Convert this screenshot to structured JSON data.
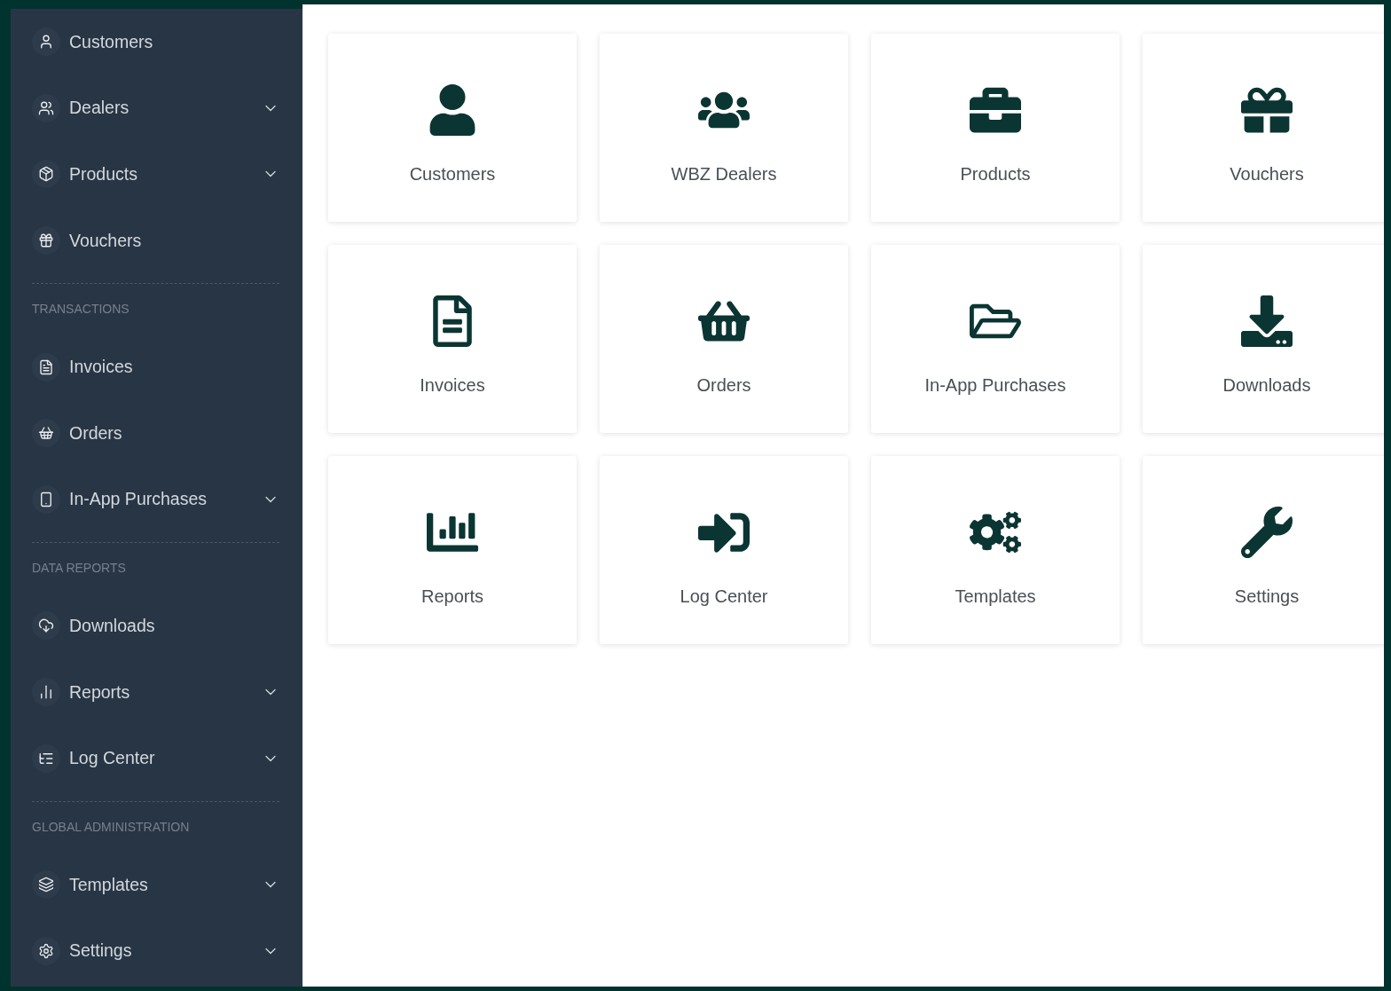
{
  "sidebar": {
    "entries": [
      {
        "kind": "item",
        "label": "Customers",
        "expandable": false
      },
      {
        "kind": "item",
        "label": "Dealers",
        "expandable": true
      },
      {
        "kind": "item",
        "label": "Products",
        "expandable": true
      },
      {
        "kind": "item",
        "label": "Vouchers",
        "expandable": false
      },
      {
        "kind": "heading",
        "label": "TRANSACTIONS"
      },
      {
        "kind": "item",
        "label": "Invoices",
        "expandable": false
      },
      {
        "kind": "item",
        "label": "Orders",
        "expandable": false
      },
      {
        "kind": "item",
        "label": "In-App Purchases",
        "expandable": true
      },
      {
        "kind": "heading",
        "label": "DATA REPORTS"
      },
      {
        "kind": "item",
        "label": "Downloads",
        "expandable": false
      },
      {
        "kind": "item",
        "label": "Reports",
        "expandable": true
      },
      {
        "kind": "item",
        "label": "Log Center",
        "expandable": true
      },
      {
        "kind": "heading",
        "label": "GLOBAL ADMINISTRATION"
      },
      {
        "kind": "item",
        "label": "Templates",
        "expandable": true
      },
      {
        "kind": "item",
        "label": "Settings",
        "expandable": true
      }
    ]
  },
  "tiles": [
    {
      "label": "Customers"
    },
    {
      "label": "WBZ Dealers"
    },
    {
      "label": "Products"
    },
    {
      "label": "Vouchers"
    },
    {
      "label": "Invoices"
    },
    {
      "label": "Orders"
    },
    {
      "label": "In-App Purchases"
    },
    {
      "label": "Downloads"
    },
    {
      "label": "Reports"
    },
    {
      "label": "Log Center"
    },
    {
      "label": "Templates"
    },
    {
      "label": "Settings"
    }
  ]
}
